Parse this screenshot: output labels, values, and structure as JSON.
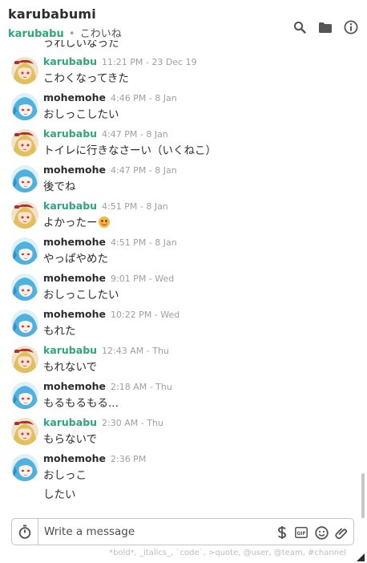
{
  "header": {
    "title": "karubabumi",
    "subtitle_user": "karubabu",
    "subtitle_sep": "•",
    "subtitle_topic": "こわいね"
  },
  "icons": {
    "search": "search-icon",
    "files": "folder-icon",
    "info": "info-icon",
    "timer": "stopwatch-icon",
    "dollar": "dollar-icon",
    "gif": "gif-icon",
    "emoji": "smiley-icon",
    "attach": "paperclip-icon"
  },
  "colors": {
    "accent_green": "#2fa67a",
    "text": "#2c2d30",
    "timestamp": "#9e9ea6"
  },
  "partial_top_text": "うれしいなった",
  "messages": [
    {
      "author": "karubabu",
      "avatar": "blonde",
      "time": "11:21 PM - 23 Dec 19",
      "lines": [
        "こわくなってきた"
      ],
      "emoji": false
    },
    {
      "author": "mohemohe",
      "avatar": "blue",
      "time": "4:46 PM - 8 Jan",
      "lines": [
        "おしっこしたい"
      ],
      "emoji": false
    },
    {
      "author": "karubabu",
      "avatar": "blonde",
      "time": "4:47 PM - 8 Jan",
      "lines": [
        "トイレに行きなさーい（いくねこ）"
      ],
      "emoji": false
    },
    {
      "author": "mohemohe",
      "avatar": "blue",
      "time": "4:47 PM - 8 Jan",
      "lines": [
        "後でね"
      ],
      "emoji": false
    },
    {
      "author": "karubabu",
      "avatar": "blonde",
      "time": "4:51 PM - 8 Jan",
      "lines": [
        "よかったー"
      ],
      "emoji": true
    },
    {
      "author": "mohemohe",
      "avatar": "blue",
      "time": "4:51 PM - 8 Jan",
      "lines": [
        "やっぱやめた"
      ],
      "emoji": false
    },
    {
      "author": "mohemohe",
      "avatar": "blue",
      "time": "9:01 PM - Wed",
      "lines": [
        "おしっこしたい"
      ],
      "emoji": false
    },
    {
      "author": "mohemohe",
      "avatar": "blue",
      "time": "10:22 PM - Wed",
      "lines": [
        "もれた"
      ],
      "emoji": false
    },
    {
      "author": "karubabu",
      "avatar": "blonde",
      "time": "12:43 AM - Thu",
      "lines": [
        "もれないで"
      ],
      "emoji": false
    },
    {
      "author": "mohemohe",
      "avatar": "blue",
      "time": "2:18 AM - Thu",
      "lines": [
        "もるもるもる..."
      ],
      "emoji": false
    },
    {
      "author": "karubabu",
      "avatar": "blonde",
      "time": "2:30 AM - Thu",
      "lines": [
        "もらないで"
      ],
      "emoji": false
    },
    {
      "author": "mohemohe",
      "avatar": "blue",
      "time": "2:36 PM",
      "lines": [
        "おしっこ",
        "したい"
      ],
      "emoji": false
    }
  ],
  "composer": {
    "placeholder": "Write a message",
    "gif_label": "GIF",
    "hint": "*bold*, _italics_, `code`, >quote, @user, @team, #channel"
  }
}
